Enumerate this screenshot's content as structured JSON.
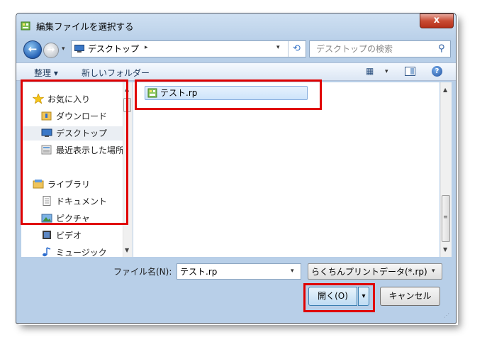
{
  "window": {
    "title": "編集ファイルを選択する",
    "close_glyph": "x"
  },
  "nav": {
    "back_glyph": "←",
    "forward_glyph": "→",
    "address_location": "デスクトップ",
    "address_chevron": "▸",
    "dropdown_glyph": "▾",
    "refresh_glyph": "⟲",
    "search_placeholder": "デスクトップの検索",
    "search_glyph": "⚲"
  },
  "toolbar": {
    "organize_label": "整理 ▾",
    "new_folder_label": "新しいフォルダー",
    "view_glyph": "▦",
    "help_glyph": "?"
  },
  "sidebar": {
    "items": [
      {
        "label": "お気に入り",
        "icon": "star-icon"
      },
      {
        "label": "ダウンロード",
        "icon": "download-folder-icon"
      },
      {
        "label": "デスクトップ",
        "icon": "desktop-icon"
      },
      {
        "label": "最近表示した場所",
        "icon": "recent-places-icon"
      },
      {
        "label": "ライブラリ",
        "icon": "library-icon"
      },
      {
        "label": "ドキュメント",
        "icon": "document-icon"
      },
      {
        "label": "ピクチャ",
        "icon": "picture-icon"
      },
      {
        "label": "ビデオ",
        "icon": "video-icon"
      },
      {
        "label": "ミュージック",
        "icon": "music-icon"
      }
    ]
  },
  "files": [
    {
      "name": "テスト.rp",
      "icon": "rp-file-icon",
      "selected": true
    }
  ],
  "bottom": {
    "filename_label": "ファイル名(N):",
    "filename_value": "テスト.rp",
    "filter_value": "らくちんプリントデータ(*.rp)",
    "open_label": "開く(O)",
    "open_dropdown_glyph": "▾",
    "cancel_label": "キャンセル"
  },
  "colors": {
    "highlight": "#e00000",
    "selection": "#cde4fb"
  }
}
